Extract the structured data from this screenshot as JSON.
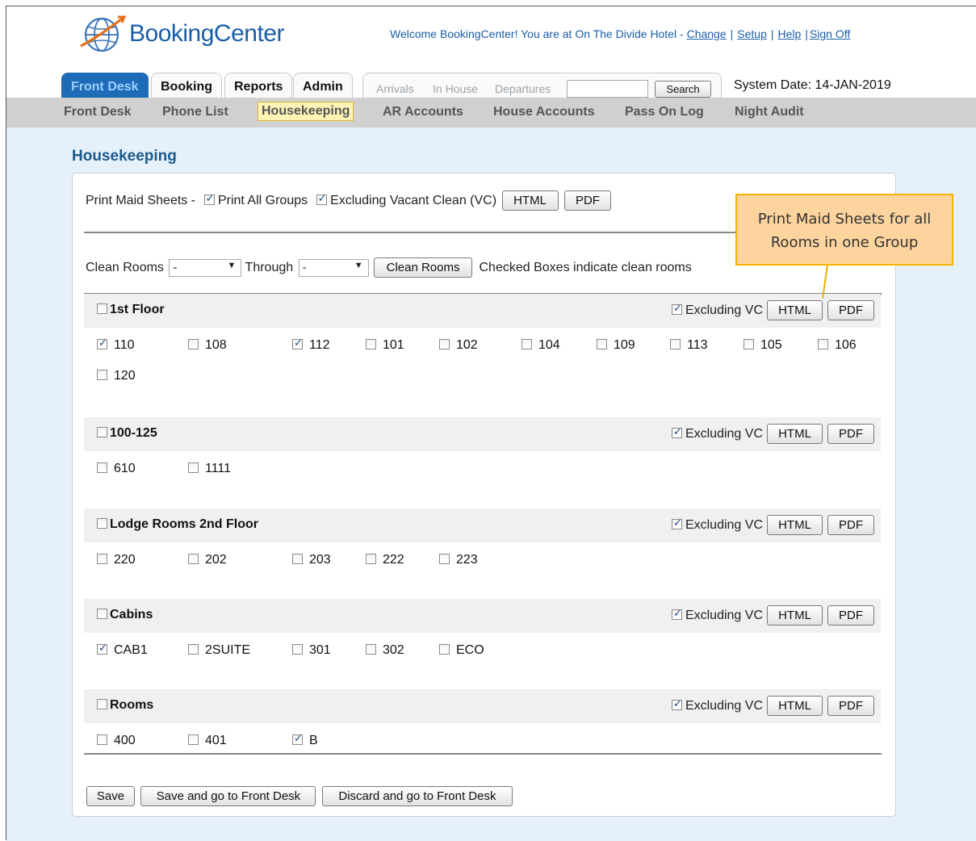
{
  "app": {
    "name": "BookingCenter"
  },
  "header": {
    "welcome_text": "Welcome BookingCenter! You are at On The Divide Hotel -",
    "links": {
      "change": "Change",
      "setup": "Setup",
      "help": "Help",
      "signoff": "Sign Off"
    },
    "sep": "|"
  },
  "tabs": [
    {
      "label": "Front Desk",
      "active": true
    },
    {
      "label": "Booking"
    },
    {
      "label": "Reports"
    },
    {
      "label": "Admin"
    }
  ],
  "search": {
    "arrivals": "Arrivals",
    "inhouse": "In House",
    "departures": "Departures",
    "value": "",
    "button": "Search"
  },
  "system_date": "System Date: 14-JAN-2019",
  "subnav": [
    "Front Desk",
    "Phone List",
    "Housekeeping",
    "AR Accounts",
    "House Accounts",
    "Pass On Log",
    "Night Audit"
  ],
  "page": {
    "title": "Housekeeping",
    "print_label": "Print Maid Sheets -",
    "print_all_groups": "Print All Groups",
    "excluding_vc_full": "Excluding Vacant Clean (VC)",
    "html": "HTML",
    "pdf": "PDF",
    "clean_rooms_label": "Clean Rooms",
    "through": "Through",
    "select_from": "-",
    "select_to": "-",
    "clean_rooms_button": "Clean Rooms",
    "clean_hint": "Checked Boxes indicate clean rooms",
    "excluding_vc": "Excluding VC",
    "save": "Save",
    "save_front_desk": "Save and go to Front Desk",
    "discard_front_desk": "Discard and go to Front Desk"
  },
  "groups": [
    {
      "name": "1st Floor",
      "rooms": [
        {
          "no": "110",
          "clean": true
        },
        {
          "no": "108",
          "clean": false
        },
        {
          "no": "112",
          "clean": true
        },
        {
          "no": "101",
          "clean": false
        },
        {
          "no": "102",
          "clean": false
        },
        {
          "no": "104",
          "clean": false
        },
        {
          "no": "109",
          "clean": false
        },
        {
          "no": "113",
          "clean": false
        },
        {
          "no": "105",
          "clean": false
        },
        {
          "no": "106",
          "clean": false
        },
        {
          "no": "120",
          "clean": false
        }
      ]
    },
    {
      "name": "100-125",
      "rooms": [
        {
          "no": "610",
          "clean": false
        },
        {
          "no": "1111",
          "clean": false
        }
      ]
    },
    {
      "name": "Lodge Rooms 2nd Floor",
      "rooms": [
        {
          "no": "220",
          "clean": false
        },
        {
          "no": "202",
          "clean": false
        },
        {
          "no": "203",
          "clean": false
        },
        {
          "no": "222",
          "clean": false
        },
        {
          "no": "223",
          "clean": false
        }
      ]
    },
    {
      "name": "Cabins",
      "rooms": [
        {
          "no": "CAB1",
          "clean": true
        },
        {
          "no": "2SUITE",
          "clean": false
        },
        {
          "no": "301",
          "clean": false
        },
        {
          "no": "302",
          "clean": false
        },
        {
          "no": "ECO",
          "clean": false
        }
      ]
    },
    {
      "name": "Rooms",
      "rooms": [
        {
          "no": "400",
          "clean": false
        },
        {
          "no": "401",
          "clean": false
        },
        {
          "no": "B",
          "clean": true
        }
      ]
    }
  ],
  "callout": {
    "line1": "Print Maid Sheets for all",
    "line2": "Rooms in one Group"
  }
}
